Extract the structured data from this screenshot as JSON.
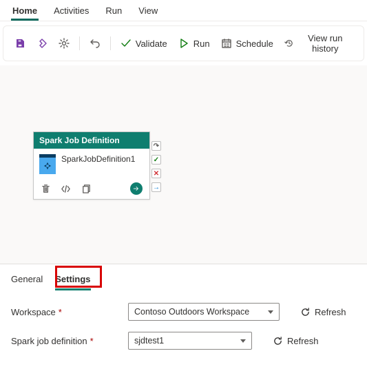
{
  "menu": {
    "tabs": [
      "Home",
      "Activities",
      "Run",
      "View"
    ],
    "active": 0
  },
  "toolbar": {
    "validate_label": "Validate",
    "run_label": "Run",
    "schedule_label": "Schedule",
    "history_label": "View run history"
  },
  "canvas": {
    "card": {
      "header": "Spark Job Definition",
      "name": "SparkJobDefinition1"
    }
  },
  "prop": {
    "tabs": {
      "general": "General",
      "settings": "Settings"
    },
    "active": "settings",
    "rows": {
      "workspace": {
        "label": "Workspace",
        "value": "Contoso Outdoors Workspace",
        "refresh": "Refresh"
      },
      "sjd": {
        "label": "Spark job definition",
        "value": "sjdtest1",
        "refresh": "Refresh"
      }
    }
  }
}
